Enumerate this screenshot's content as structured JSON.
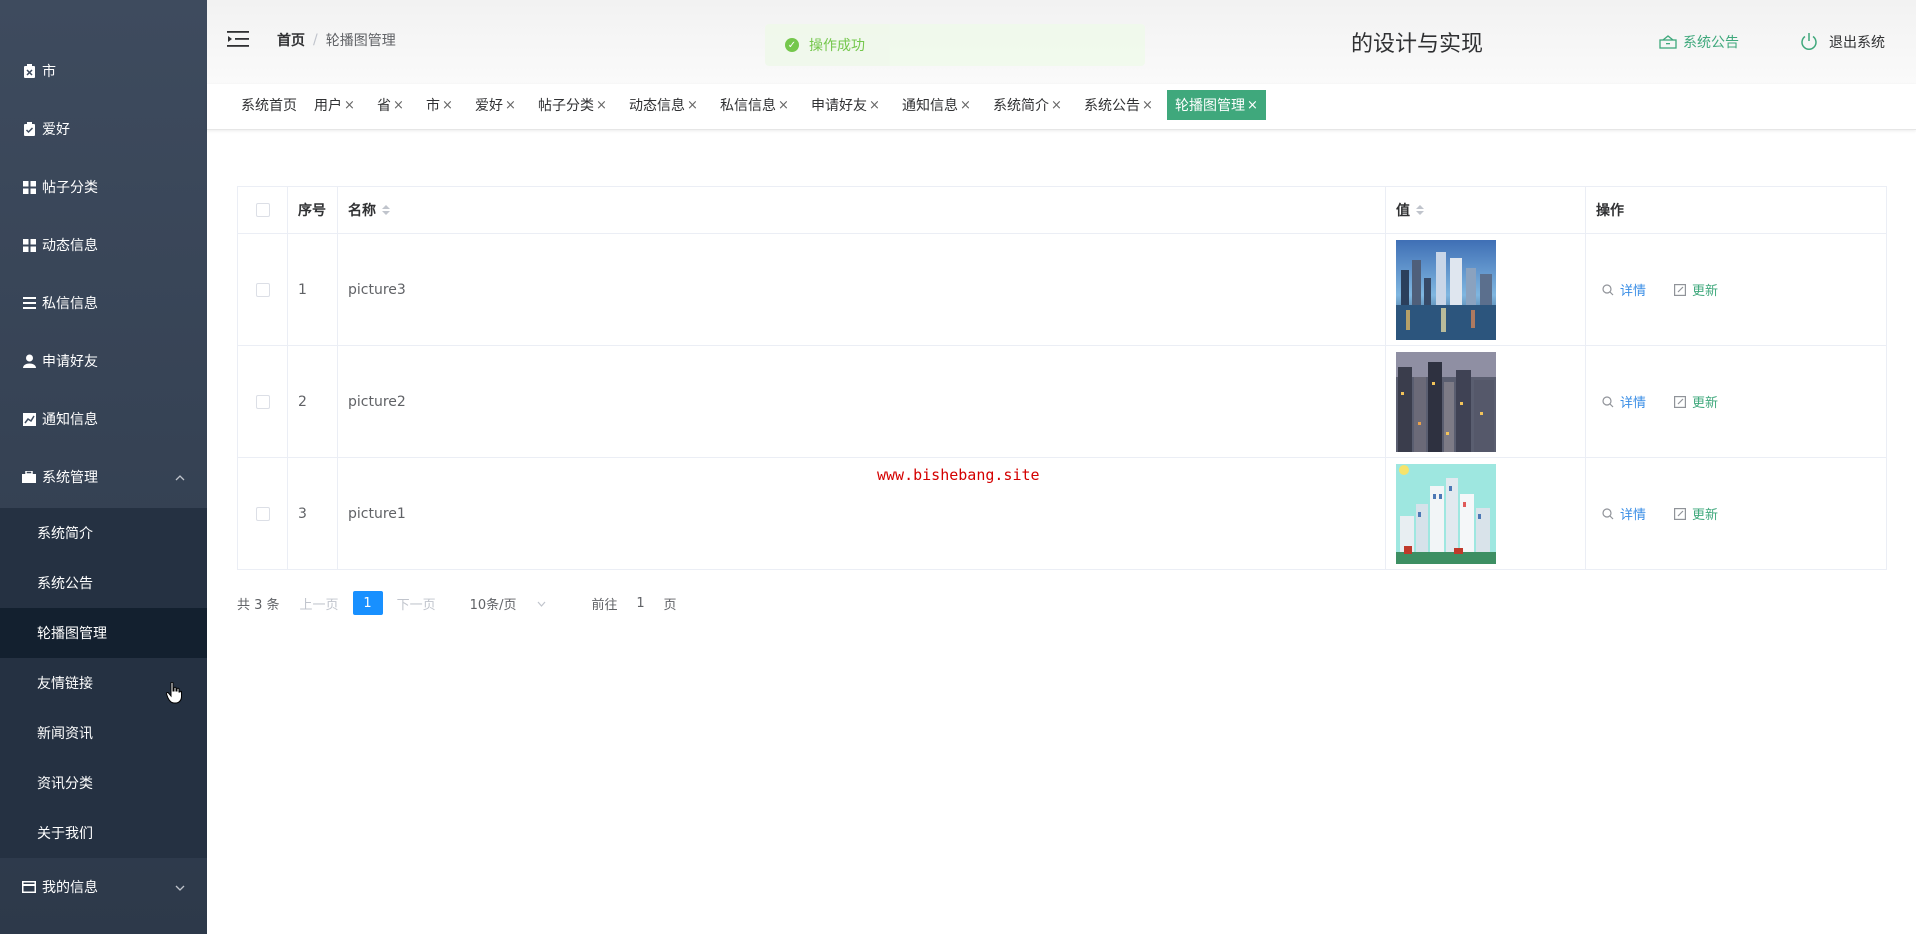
{
  "sidebar": {
    "items": [
      {
        "label": "市",
        "icon": "clipboard-icon"
      },
      {
        "label": "爱好",
        "icon": "clipboard-check-icon"
      },
      {
        "label": "帖子分类",
        "icon": "grid-icon"
      },
      {
        "label": "动态信息",
        "icon": "grid-icon"
      },
      {
        "label": "私信信息",
        "icon": "list-icon"
      },
      {
        "label": "申请好友",
        "icon": "user-icon"
      },
      {
        "label": "通知信息",
        "icon": "chart-icon"
      },
      {
        "label": "系统管理",
        "icon": "briefcase-icon"
      }
    ],
    "submenu": [
      {
        "label": "系统简介"
      },
      {
        "label": "系统公告"
      },
      {
        "label": "轮播图管理"
      },
      {
        "label": "友情链接"
      },
      {
        "label": "新闻资讯"
      },
      {
        "label": "资讯分类"
      },
      {
        "label": "关于我们"
      }
    ],
    "my_info": {
      "label": "我的信息",
      "icon": "card-icon"
    }
  },
  "header": {
    "breadcrumb_home": "首页",
    "breadcrumb_separator": "/",
    "breadcrumb_current": "轮播图管理",
    "title_fragment": "的设计与实现",
    "toast": "操作成功",
    "notice": "系统公告",
    "logout": "退出系统"
  },
  "tags": [
    {
      "label": "系统首页",
      "closable": false
    },
    {
      "label": "用户",
      "closable": true
    },
    {
      "label": "省",
      "closable": true
    },
    {
      "label": "市",
      "closable": true
    },
    {
      "label": "爱好",
      "closable": true
    },
    {
      "label": "帖子分类",
      "closable": true
    },
    {
      "label": "动态信息",
      "closable": true
    },
    {
      "label": "私信信息",
      "closable": true
    },
    {
      "label": "申请好友",
      "closable": true
    },
    {
      "label": "通知信息",
      "closable": true
    },
    {
      "label": "系统简介",
      "closable": true
    },
    {
      "label": "系统公告",
      "closable": true
    },
    {
      "label": "轮播图管理",
      "closable": true,
      "active": true
    }
  ],
  "tag_close_glyph": "×",
  "table": {
    "columns": {
      "index": "序号",
      "name": "名称",
      "value": "值",
      "actions": "操作"
    },
    "rows": [
      {
        "index": "1",
        "name": "picture3"
      },
      {
        "index": "2",
        "name": "picture2"
      },
      {
        "index": "3",
        "name": "picture1"
      }
    ],
    "action_detail": "详情",
    "action_update": "更新"
  },
  "watermark": "www.bishebang.site",
  "pagination": {
    "total": "共 3 条",
    "prev": "上一页",
    "current_page": "1",
    "next": "下一页",
    "page_size": "10条/页",
    "goto_label": "前往",
    "goto_value": "1",
    "goto_suffix": "页"
  },
  "colors": {
    "accent": "#3fa87c",
    "sidebar_bg": "#3e4b5e",
    "submenu_bg": "#253142",
    "submenu_active": "#13202f",
    "page_active": "#1890ff"
  }
}
